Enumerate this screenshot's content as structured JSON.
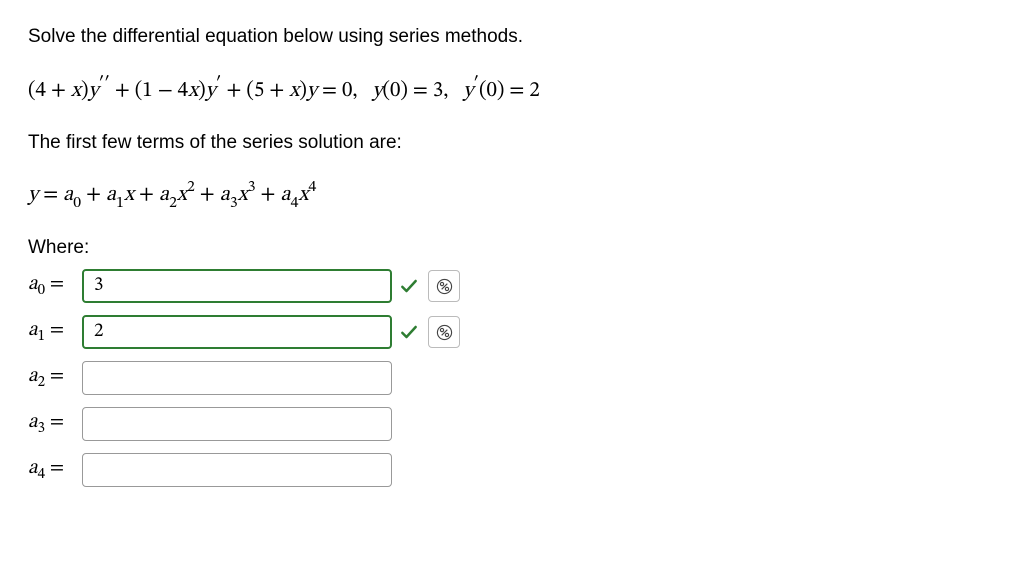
{
  "problem": {
    "prompt": "Solve the differential equation below using series methods.",
    "equation_html": "(4 + <i>x</i>)<i>y</i><span class='prime'>′′</span> + (1 − 4<i>x</i>)<i>y</i><span class='prime'>′</span> + (5 + <i>x</i>)<i>y</i> = 0, &nbsp;&nbsp;<i>y</i>(0) = 3, &nbsp;&nbsp;<i>y</i><span class='prime'>′</span>(0) = 2",
    "series_intro": "The first few terms of the series solution are:",
    "series_html": "<i>y</i> = <i>a</i><span class='sub'>0</span> + <i>a</i><span class='sub'>1</span><i>x</i> + <i>a</i><span class='sub'>2</span><i>x</i><span class='sup'>2</span> + <i>a</i><span class='sub'>3</span><i>x</i><span class='sup'>3</span> + <i>a</i><span class='sub'>4</span><i>x</i><span class='sup'>4</span>",
    "where_label": "Where:"
  },
  "coeffs": [
    {
      "label_html": "<i>a</i><span class='sub'>0</span> =",
      "value": "3",
      "status": "correct"
    },
    {
      "label_html": "<i>a</i><span class='sub'>1</span> =",
      "value": "2",
      "status": "correct"
    },
    {
      "label_html": "<i>a</i><span class='sub'>2</span> =",
      "value": "",
      "status": "blank"
    },
    {
      "label_html": "<i>a</i><span class='sub'>3</span> =",
      "value": "",
      "status": "blank"
    },
    {
      "label_html": "<i>a</i><span class='sub'>4</span> =",
      "value": "",
      "status": "blank"
    }
  ]
}
